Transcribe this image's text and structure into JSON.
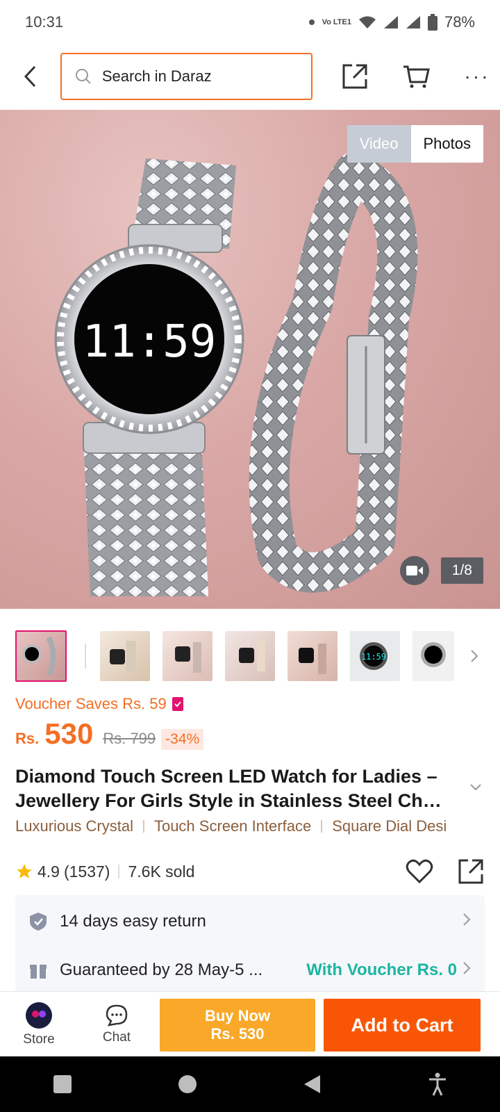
{
  "status": {
    "time": "10:31",
    "battery": "78%",
    "network_label": "Vo LTE1"
  },
  "search": {
    "placeholder": "Search in Daraz"
  },
  "gallery": {
    "tabs": [
      "Video",
      "Photos"
    ],
    "counter": "1/8",
    "watch_display": "11:59"
  },
  "voucher": {
    "text": "Voucher Saves Rs. 59"
  },
  "price": {
    "currency": "Rs.",
    "current": "530",
    "original": "Rs. 799",
    "discount": "-34%"
  },
  "product": {
    "title": "Diamond Touch Screen LED Watch for Ladies –Jewellery For Girls Style in Stainless Steel Ch…",
    "tags": [
      "Luxurious Crystal",
      "Touch Screen Interface",
      "Square Dial Desi"
    ]
  },
  "rating": {
    "score": "4.9",
    "count": "(1537)",
    "sold": "7.6K sold"
  },
  "services": {
    "return": "14 days easy return",
    "delivery": "Guaranteed by 28 May-5 ...",
    "voucher": "With Voucher Rs. 0"
  },
  "bottom": {
    "store": "Store",
    "chat": "Chat",
    "buy_now": "Buy Now",
    "buy_price": "Rs. 530",
    "add_to_cart": "Add to Cart"
  },
  "colors": {
    "accent": "#f85606",
    "buy": "#f9a829",
    "voucher": "#f36f24",
    "teal": "#1bb5a2"
  }
}
